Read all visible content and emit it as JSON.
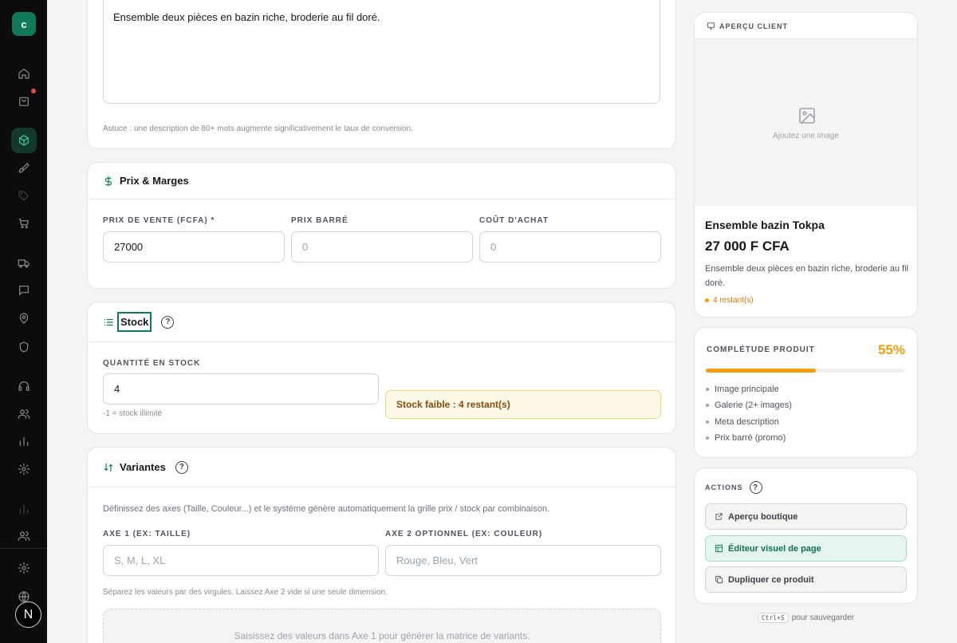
{
  "sidebar": {
    "brand": "c",
    "items": [
      "home-icon",
      "bag-icon",
      "box-icon",
      "brush-icon",
      "tag-icon",
      "cart-icon",
      "truck-icon",
      "chat-icon",
      "location-icon",
      "shield-icon",
      "headset-icon",
      "users-icon",
      "chart-icon",
      "gear-icon",
      "chart-dim-icon",
      "users-2-icon",
      "gear-2-icon",
      "globe-icon"
    ],
    "avatar": "N"
  },
  "description": {
    "text": "Ensemble deux pièces en bazin riche, broderie au fil doré.",
    "hint": "Astuce : une description de 80+ mots augmente significativement le taux de conversion."
  },
  "pricing": {
    "title": "Prix & Marges",
    "sale_price_label": "PRIX DE VENTE (FCFA) *",
    "sale_price_value": "27000",
    "struck_label": "PRIX BARRÉ",
    "struck_placeholder": "0",
    "cost_label": "COÛT D'ACHAT",
    "cost_placeholder": "0"
  },
  "stock": {
    "title": "Stock",
    "help": "?",
    "qty_label": "QUANTITÉ EN STOCK",
    "qty_value": "4",
    "qty_hint": "-1 = stock illimité",
    "alert": "Stock faible : 4 restant(s)"
  },
  "variants": {
    "title": "Variantes",
    "help": "?",
    "intro": "Définissez des axes (Taille, Couleur...) et le système génère automatiquement la grille prix / stock par combinaison.",
    "axis1_label": "AXE 1 (EX: TAILLE)",
    "axis1_placeholder": "S, M, L, XL",
    "axis2_label": "AXE 2 OPTIONNEL (EX: COULEUR)",
    "axis2_placeholder": "Rouge, Bleu, Vert",
    "hint": "Séparez les valeurs par des virgules. Laissez Axe 2 vide si une seule dimension.",
    "empty": "Saisissez des valeurs dans Axe 1 pour générer la matrice de variants."
  },
  "preview": {
    "header": "APERÇU CLIENT",
    "image_placeholder": "Ajoutez une image",
    "product_name": "Ensemble bazin Tokpa",
    "price": "27 000 F CFA",
    "description": "Ensemble deux pièces en bazin riche, broderie au fil doré.",
    "stock_note": "4 restant(s)"
  },
  "completeness": {
    "title": "COMPLÉTUDE PRODUIT",
    "percent_label": "55%",
    "percent": 55,
    "items": [
      "Image principale",
      "Galerie (2+ images)",
      "Meta description",
      "Prix barré (promo)"
    ]
  },
  "actions": {
    "title": "ACTIONS",
    "help": "?",
    "shop_preview": "Aperçu boutique",
    "visual_editor": "Éditeur visuel de page",
    "duplicate": "Dupliquer ce produit",
    "shortcut_key": "Ctrl+S",
    "shortcut_text": "pour sauvegarder"
  },
  "colors": {
    "accent": "#0f7a5a",
    "warning": "#f59e0b",
    "sidebar": "#0c0c0d"
  }
}
